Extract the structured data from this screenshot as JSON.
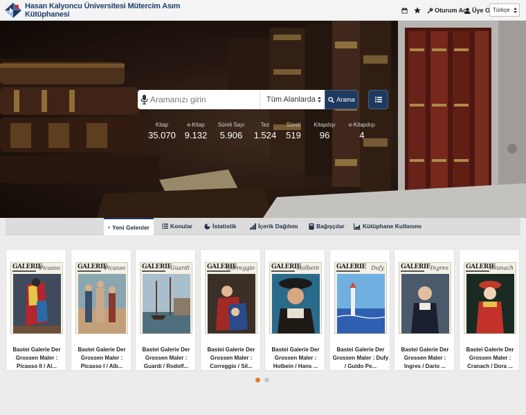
{
  "header": {
    "title": "Hasan Kalyoncu Üniversitesi Mütercim Asım Kütüphanesi",
    "calendar_icon": "calendar-icon",
    "favorites_icon": "star-icon",
    "login_label": "Oturum Aç",
    "register_label": "Üye Ol",
    "language": "Türkçe"
  },
  "search": {
    "placeholder": "Aramanızı girin",
    "field": "Tüm Alanlarda",
    "button_label": "Arama"
  },
  "stats": [
    {
      "label": "Kitap",
      "value": "35.070"
    },
    {
      "label": "e-Kitap",
      "value": "9.132"
    },
    {
      "label": "Süreli Sayı",
      "value": "5.906"
    },
    {
      "label": "Tez",
      "value": "1.524"
    },
    {
      "label": "Süreli",
      "value": "519"
    },
    {
      "label": "Kitapdışı",
      "value": "96"
    },
    {
      "label": "e-Kitapdışı",
      "value": "4"
    }
  ],
  "tabs": [
    {
      "label": "Yeni Gelenler",
      "icon": "double-chevron-down-icon",
      "active": true
    },
    {
      "label": "Konular",
      "icon": "list-icon"
    },
    {
      "label": "İstatistik",
      "icon": "pie-chart-icon"
    },
    {
      "label": "İçerik Dağılımı",
      "icon": "bar-chart-icon"
    },
    {
      "label": "Bağışçılar",
      "icon": "book-icon"
    },
    {
      "label": "Kütüphane Kullanımı",
      "icon": "area-chart-icon"
    }
  ],
  "books": [
    {
      "cover_brand": "GALERIE",
      "artist": "Picasso",
      "title": "Bastei Galerie Der Grossen Maler : Picasso II / Al..."
    },
    {
      "cover_brand": "GALERIE",
      "artist": "Picasso",
      "title": "Bastei Galerie Der Grossen Maler : Picasso I / Alb..."
    },
    {
      "cover_brand": "GALERIE",
      "artist": "Guardi",
      "title": "Bastei Galerie Der Grossen Maler : Guardi / Rodolf..."
    },
    {
      "cover_brand": "GALERIE",
      "artist": "Correggio",
      "title": "Bastei Galerie Der Grossen Maler : Correggio / Sil..."
    },
    {
      "cover_brand": "GALERIE",
      "artist": "Holbein",
      "title": "Bastei Galerie Der Grossen Maler : Holbein / Hans ..."
    },
    {
      "cover_brand": "GALERIE",
      "artist": "Dufy",
      "title": "Bastei Galerie Der Grossen Maler : Dufy / Guido Pe..."
    },
    {
      "cover_brand": "GALERIE",
      "artist": "Ingres",
      "title": "Bastei Galerie Der Grossen Maler : Ingres / Dario ..."
    },
    {
      "cover_brand": "GALERIE",
      "artist": "Cranach",
      "title": "Bastei Galerie Der Grossen Maler : Cranach / Dora ..."
    }
  ],
  "carousel": {
    "pages": 2,
    "active_page": 1
  },
  "colors": {
    "brand_navy": "#1f3a5e",
    "accent_orange": "#e07b2e"
  }
}
